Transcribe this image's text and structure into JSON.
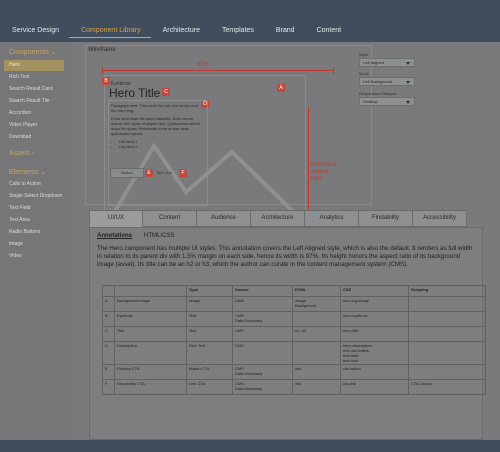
{
  "nav": [
    "Service Design",
    "Component Library",
    "Architecture",
    "Templates",
    "Brand",
    "Content"
  ],
  "sidebar": {
    "components_head": "Components",
    "components": [
      "Hero",
      "Rich Text",
      "Search Result Card",
      "Search Result Tile",
      "Accordion",
      "Video Player",
      "Download"
    ],
    "assets_head": "Assets",
    "elements_head": "Elements",
    "elements": [
      "Calls to Action",
      "Single Select Dropdown",
      "Text Field",
      "Text Area",
      "Radio Buttons",
      "Image",
      "Video"
    ]
  },
  "wireframe": {
    "label": "Wireframe",
    "width_pct": "97%",
    "aspect_note": [
      "Maintains",
      "aspect",
      "ratio"
    ],
    "badges": [
      "A",
      "B",
      "C",
      "D",
      "E",
      "F"
    ],
    "eyebrow": "Eyebrow",
    "title": "Hero Title",
    "description": [
      "Paragraph text. This could be rich line lumps over the hero img.",
      "Enim sunt sitae elit amet blanditis. Enim rerum dolore elim quas ut aliquid quo. Quibusdam officiis dolor illo quasi. Reiciendis enim autem alias quibusdam ipsum."
    ],
    "list": [
      "List Item 1",
      "List Item 2"
    ],
    "primary_cta": "Button",
    "secondary_cta": "Text Link"
  },
  "controls": {
    "style_label": "Style",
    "style_value": "Left Aligned",
    "mode_label": "Mode",
    "mode_value": "Left Background",
    "viewport_label": "Responsive Viewport",
    "viewport_value": "Desktop"
  },
  "tabs": [
    "UI/UX",
    "Content",
    "Audience",
    "Architecture",
    "Analytics",
    "Findability",
    "Accessibility"
  ],
  "subtabs": [
    "Annotations",
    "HTML/CSS"
  ],
  "annotation": "The Hero component has multiple UI styles. This annotation covers the Left Aligned style, which is also the default. It renders as full width in relation to its parent div with 1.5% margin on each side, hence its width is 97%. Its height honors the aspect ratio of its background image (asset). Its title can be an h2 or h3, which the author can curate in the content management system (CMS).",
  "table": {
    "headers": [
      "",
      "",
      "Type",
      "Source",
      "HTML",
      "CSS",
      "Scripting"
    ],
    "rows": [
      [
        "A",
        "Background image",
        "Image",
        "DAM",
        "image\nBackground",
        "hero-bg-image",
        ""
      ],
      [
        "B",
        "Eyebrow",
        "Text",
        "CMS\nData Dictionary",
        "",
        "hero-eyebrow",
        ""
      ],
      [
        "C",
        "Title",
        "Text",
        "CMS",
        "h2, h3",
        "hero-title",
        ""
      ],
      [
        "D",
        "Description",
        "Rich Text",
        "CMS",
        "",
        "hero-description\ntext dot bullets\ntext italic\ntext bold",
        ""
      ],
      [
        "E",
        "Primary CTA",
        "Button CTA",
        "CMS\nData Dictionary",
        "link",
        "cta-button",
        ""
      ],
      [
        "F",
        "Secondary CTA",
        "Link CTA",
        "CMS\nData Dictionary",
        "link",
        "cta-link",
        "CTA Library"
      ]
    ]
  }
}
